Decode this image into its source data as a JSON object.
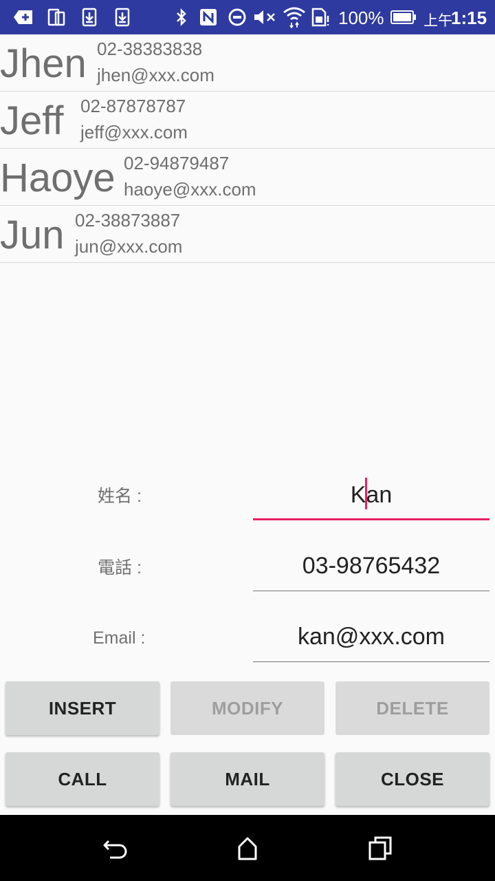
{
  "status_bar": {
    "battery_percent": "100%",
    "time_prefix": "上午",
    "time": "1:15",
    "icons": [
      "add-notification-icon",
      "dual-screen-icon",
      "download-icon",
      "download-icon",
      "bluetooth-icon",
      "nfc-icon",
      "dnd-icon",
      "mute-icon",
      "wifi-icon",
      "sim-icon",
      "battery-icon"
    ],
    "bg_color": "#2e3a9f"
  },
  "contacts": [
    {
      "name": "Jhen",
      "phone": "02-38383838",
      "email": "jhen@xxx.com"
    },
    {
      "name": "Jeff",
      "phone": "02-87878787",
      "email": "jeff@xxx.com"
    },
    {
      "name": "Haoye",
      "phone": "02-94879487",
      "email": "haoye@xxx.com"
    },
    {
      "name": "Jun",
      "phone": "02-38873887",
      "email": "jun@xxx.com"
    }
  ],
  "form": {
    "name_label": "姓名 :",
    "name_value_before_caret": "K",
    "name_value_after_caret": "an",
    "phone_label": "電話 :",
    "phone_value": "03-98765432",
    "email_label": "Email :",
    "email_value": "kan@xxx.com",
    "accent_color": "#e91e63"
  },
  "buttons": {
    "insert": "INSERT",
    "modify": "MODIFY",
    "delete": "DELETE",
    "call": "CALL",
    "mail": "MAIL",
    "close": "CLOSE"
  },
  "nav_bar": {
    "icons": [
      "back-icon",
      "home-icon",
      "recents-icon"
    ]
  }
}
